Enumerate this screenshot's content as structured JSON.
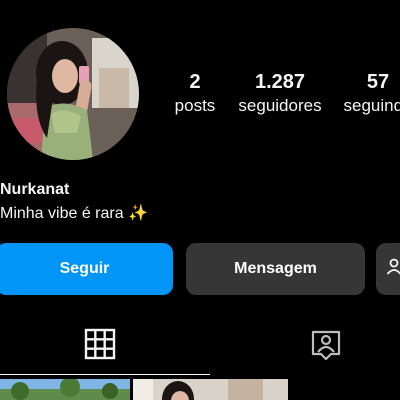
{
  "profile": {
    "username": "Nurkanat",
    "bio_text": "Minha vibe é rara",
    "bio_emoji": "✨"
  },
  "stats": {
    "posts": {
      "value": "2",
      "label": "posts"
    },
    "followers": {
      "value": "1.287",
      "label": "seguidores"
    },
    "following": {
      "value": "57",
      "label": "seguindo"
    }
  },
  "actions": {
    "follow_label": "Seguir",
    "message_label": "Mensagem",
    "suggest_icon": "person-add-icon"
  },
  "tabs": [
    {
      "icon": "grid-icon",
      "active": true
    },
    {
      "icon": "tagged-person-icon",
      "active": false
    }
  ],
  "colors": {
    "background": "#000000",
    "follow_button": "#0095f6",
    "secondary_button": "#363636",
    "text": "#f5f5f5"
  }
}
